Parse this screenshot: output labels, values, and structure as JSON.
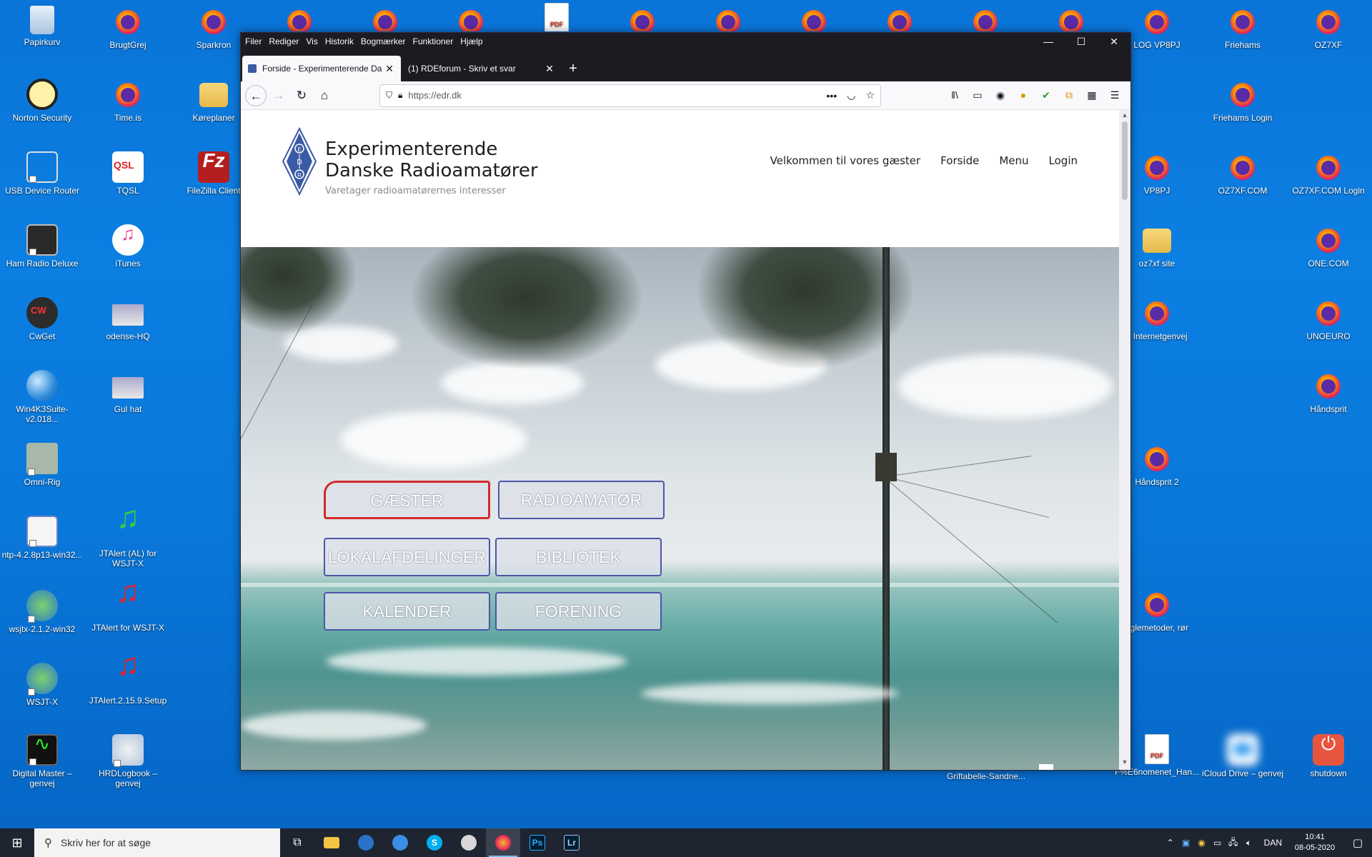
{
  "desktop": {
    "icons_left": [
      {
        "label": "Papirkurv",
        "icon": "recycle-bin-icon"
      },
      {
        "label": "Norton Security",
        "icon": "norton-icon"
      },
      {
        "label": "USB Device Router",
        "icon": "usb-icon"
      },
      {
        "label": "Ham Radio Deluxe",
        "icon": "ham-radio-icon"
      },
      {
        "label": "CwGet",
        "icon": "cwget-icon"
      },
      {
        "label": "Win4K3Suite-v2.018...",
        "icon": "globe-icon"
      },
      {
        "label": "Omni-Rig",
        "icon": "omnirig-icon"
      },
      {
        "label": "ntp-4.2.8p13-win32...",
        "icon": "ntp-icon"
      },
      {
        "label": "wsjtx-2.1.2-win32",
        "icon": "wsjtx-icon"
      },
      {
        "label": "WSJT-X",
        "icon": "wsjtx-icon"
      },
      {
        "label": "Digital Master – genvej",
        "icon": "digital-master-icon"
      }
    ],
    "icons_col2": [
      {
        "label": "BrugtGrej",
        "icon": "firefox-icon"
      },
      {
        "label": "Time.is",
        "icon": "firefox-icon"
      },
      {
        "label": "TQSL",
        "icon": "tqsl-icon"
      },
      {
        "label": "iTunes",
        "icon": "itunes-icon"
      },
      {
        "label": "odense-HQ",
        "icon": "photo-icon"
      },
      {
        "label": "Gul hat",
        "icon": "photo-icon"
      },
      {
        "label": "JTAlert (AL) for WSJT-X",
        "icon": "music-note-icon"
      },
      {
        "label": "JTAlert for WSJT-X",
        "icon": "music-note-icon"
      },
      {
        "label": "JTAlert.2.15.9.Setup",
        "icon": "music-note-icon"
      },
      {
        "label": "HRDLogbook – genvej",
        "icon": "hrd-icon"
      }
    ],
    "icons_col3": [
      {
        "label": "Sparkron",
        "icon": "firefox-icon"
      },
      {
        "label": "Køreplaner",
        "icon": "folder-icon"
      },
      {
        "label": "FileZilla Client",
        "icon": "filezilla-icon"
      }
    ],
    "icons_right_col1": [
      {
        "label": "LOG VP8PJ",
        "icon": "firefox-icon"
      },
      {
        "label": "VP8PJ",
        "icon": "firefox-icon"
      },
      {
        "label": "oz7xf site",
        "icon": "folder-icon"
      },
      {
        "label": "y Internetgenvej",
        "icon": "firefox-icon"
      },
      {
        "label": "Håndsprit 2",
        "icon": "firefox-icon"
      },
      {
        "label": "eglemetoder, rør",
        "icon": "firefox-icon"
      },
      {
        "label": "F%E6nomenet_Han...",
        "icon": "pdf-icon"
      }
    ],
    "icons_right_col2": [
      {
        "label": "Friehams",
        "icon": "firefox-icon"
      },
      {
        "label": "Friehams Login",
        "icon": "firefox-icon"
      },
      {
        "label": "OZ7XF.COM",
        "icon": "firefox-icon"
      },
      {
        "label": "iCloud Drive – genvej",
        "icon": "icloud-icon"
      }
    ],
    "icons_right_col3": [
      {
        "label": "OZ7XF",
        "icon": "firefox-icon"
      },
      {
        "label": "OZ7XF.COM Login",
        "icon": "firefox-icon"
      },
      {
        "label": "ONE.COM",
        "icon": "firefox-icon"
      },
      {
        "label": "UNOEURO",
        "icon": "firefox-icon"
      },
      {
        "label": "Håndsprit",
        "icon": "firefox-icon"
      },
      {
        "label": "shutdown",
        "icon": "power-icon"
      }
    ],
    "icon_below_browser": {
      "label": "Griftabelle-Sandne...",
      "icon": "document-icon"
    }
  },
  "browser": {
    "menu": [
      "Filer",
      "Rediger",
      "Vis",
      "Historik",
      "Bogmærker",
      "Funktioner",
      "Hjælp"
    ],
    "tabs": [
      {
        "title": "Forside - Experimenterende Da",
        "active": true
      },
      {
        "title": "(1) RDEforum - Skriv et svar",
        "active": false
      }
    ],
    "url": "https://edr.dk"
  },
  "site": {
    "logo_text": "EDR",
    "title_line1": "Experimenterende",
    "title_line2": "Danske Radioamatører",
    "tagline": "Varetager radioamatørernes interesser",
    "nav": [
      "Velkommen til vores gæster",
      "Forside",
      "Menu",
      "Login"
    ],
    "tiles": [
      "GÆSTER",
      "RADIOAMATØR",
      "LOKALAFDELINGER",
      "BIBLIOTEK",
      "KALENDER",
      "FORENING"
    ],
    "active_tile": "GÆSTER"
  },
  "taskbar": {
    "search_placeholder": "Skriv her for at søge",
    "apps": [
      "task-view",
      "file-explorer",
      "outlook",
      "thunderbird",
      "skype",
      "photos",
      "firefox",
      "photoshop",
      "lightroom"
    ],
    "app_labels": {
      "photoshop": "Ps",
      "lightroom": "Lr",
      "skype": "S"
    },
    "language": "DAN",
    "time": "10:41",
    "date": "08-05-2020"
  },
  "colors": {
    "desktop_blue": "#0a74d8",
    "browser_chrome": "#1c1b22",
    "tile_border": "#4a56a8",
    "tile_active_border": "#d12a2a"
  }
}
